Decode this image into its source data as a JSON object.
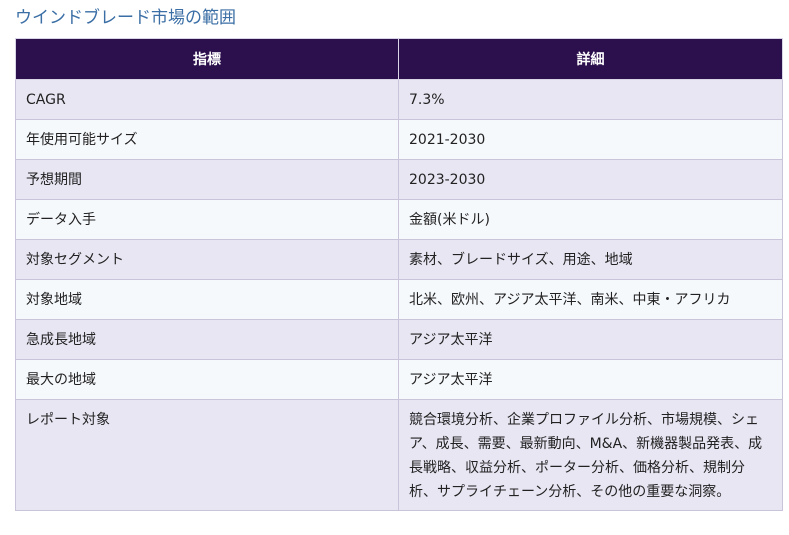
{
  "title": "ウインドブレード市場の範囲",
  "table": {
    "headers": [
      "指標",
      "詳細"
    ],
    "rows": [
      {
        "metric": "CAGR",
        "detail": "7.3%"
      },
      {
        "metric": "年使用可能サイズ",
        "detail": "2021-2030"
      },
      {
        "metric": "予想期間",
        "detail": "2023-2030"
      },
      {
        "metric": "データ入手",
        "detail": "金額(米ドル)"
      },
      {
        "metric": "対象セグメント",
        "detail": "素材、ブレードサイズ、用途、地域"
      },
      {
        "metric": "対象地域",
        "detail": "北米、欧州、アジア太平洋、南米、中東・アフリカ"
      },
      {
        "metric": "急成長地域",
        "detail": "アジア太平洋"
      },
      {
        "metric": "最大の地域",
        "detail": "アジア太平洋"
      },
      {
        "metric": "レポート対象",
        "detail": "競合環境分析、企業プロファイル分析、市場規模、シェア、成長、需要、最新動向、M&A、新機器製品発表、成長戦略、収益分析、ポーター分析、価格分析、規制分析、サプライチェーン分析、その他の重要な洞察。"
      }
    ]
  },
  "colors": {
    "title": "#3a6ea5",
    "header_bg": "#2c0f4d",
    "row_odd": "#e9e6f3",
    "row_even": "#f6f9fc"
  }
}
